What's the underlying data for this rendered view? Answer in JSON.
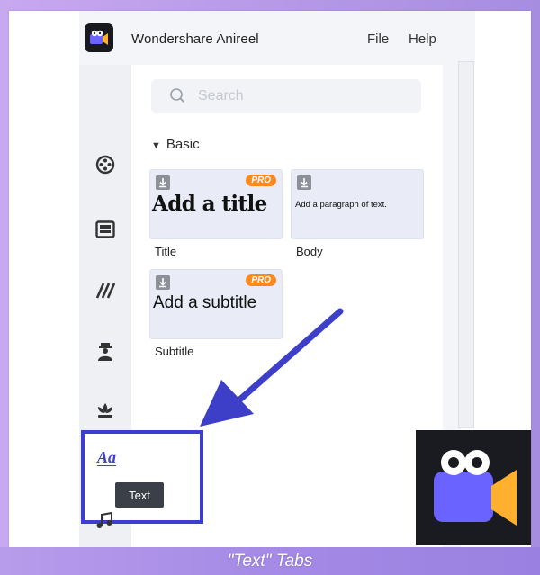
{
  "app": {
    "title": "Wondershare Anireel",
    "menu": [
      "File",
      "Help"
    ]
  },
  "sidebar": {
    "icons": [
      "film-reel-icon",
      "media-panel-icon",
      "effects-stripes-icon",
      "character-icon",
      "lotus-icon",
      "text-icon",
      "music-icon"
    ]
  },
  "search": {
    "placeholder": "Search"
  },
  "section": {
    "label": "Basic"
  },
  "cards": [
    {
      "name": "Title",
      "preview": "Add a title",
      "pro": true
    },
    {
      "name": "Body",
      "preview": "Add a paragraph of text.",
      "pro": false
    },
    {
      "name": "Subtitle",
      "preview": "Add a subtitle",
      "pro": true
    }
  ],
  "badge": {
    "pro_label": "PRO"
  },
  "tooltip": {
    "text": "Text"
  },
  "text_tab": {
    "icon_label": "Aa"
  },
  "caption": "\"Text\" Tabs",
  "colors": {
    "highlight": "#3b3ed1",
    "pro": "#ff8a1a",
    "logo_bg": "#1a1b20",
    "logo_purple": "#6a63ff",
    "logo_orange": "#ffb02e"
  }
}
